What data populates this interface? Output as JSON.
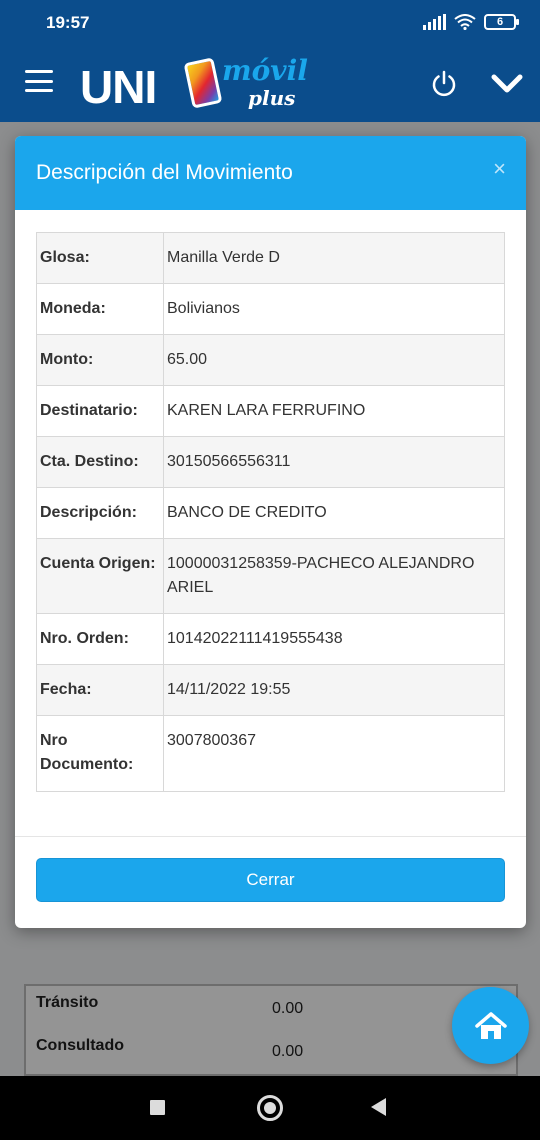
{
  "status_bar": {
    "time": "19:57",
    "battery": "6"
  },
  "app": {
    "logo_uni": "UNI",
    "logo_movil": "móvil",
    "logo_plus": "plus",
    "brand_color": "#0b4d8c",
    "accent_color": "#1ba6ec"
  },
  "modal": {
    "title": "Descripción del Movimiento",
    "close_glyph": "×",
    "rows": [
      {
        "label": "Glosa:",
        "value": "Manilla Verde D"
      },
      {
        "label": "Moneda:",
        "value": "Bolivianos"
      },
      {
        "label": "Monto:",
        "value": "65.00"
      },
      {
        "label": "Destinatario:",
        "value": "KAREN LARA FERRUFINO"
      },
      {
        "label": "Cta. Destino:",
        "value": "30150566556311"
      },
      {
        "label": "Descripción:",
        "value": "BANCO DE CREDITO"
      },
      {
        "label": "Cuenta Origen:",
        "value": "10000031258359-PACHECO ALEJANDRO ARIEL"
      },
      {
        "label": "Nro. Orden:",
        "value": "10142022111419555438"
      },
      {
        "label": "Fecha:",
        "value": "14/11/2022 19:55"
      },
      {
        "label": "Nro Documento:",
        "value": "3007800367"
      }
    ],
    "close_button": "Cerrar"
  },
  "background": {
    "rows": [
      {
        "label": "Tránsito",
        "value": "0.00"
      },
      {
        "label": "Consultado",
        "value": "0.00"
      }
    ]
  },
  "icons": {
    "menu": "hamburger-menu-icon",
    "power": "power-icon",
    "chevron": "chevron-down-icon",
    "home": "home-icon"
  }
}
